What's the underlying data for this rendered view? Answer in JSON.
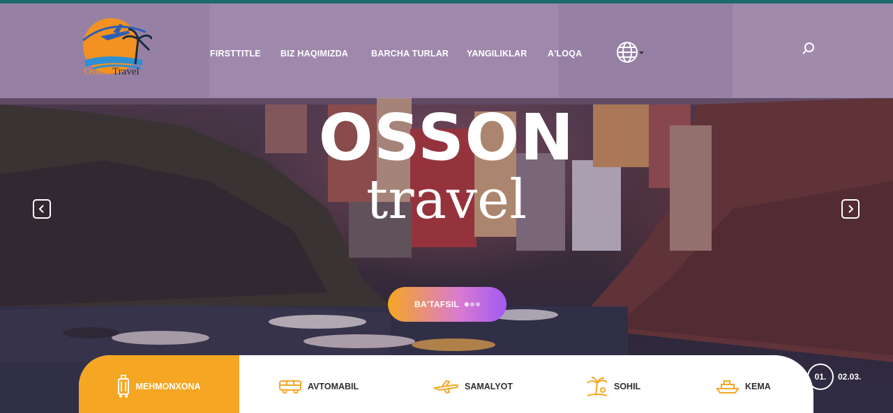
{
  "brand": {
    "name_part1": "Osson",
    "name_part2": "Travel"
  },
  "nav": {
    "items": [
      {
        "label": "FIRSTTITLE"
      },
      {
        "label": "BIZ HAQIMIZDA"
      },
      {
        "label": "BARCHA TURLAR"
      },
      {
        "label": "YANGILIKLAR"
      },
      {
        "label": "A'LOQA"
      }
    ]
  },
  "hero": {
    "title": "OSSON",
    "subtitle": "travel",
    "cta_label": "BA'TAFSIL"
  },
  "tabs": [
    {
      "label": "MEHMONXONA",
      "icon": "luggage-icon",
      "active": true
    },
    {
      "label": "AVTOMABIL",
      "icon": "bus-icon",
      "active": false
    },
    {
      "label": "SAMALYOT",
      "icon": "airplane-icon",
      "active": false
    },
    {
      "label": "SOHIL",
      "icon": "palm-beach-icon",
      "active": false
    },
    {
      "label": "KEMA",
      "icon": "ship-icon",
      "active": false
    }
  ],
  "pager": {
    "current": "01.",
    "rest": "02.03."
  },
  "colors": {
    "accent": "#f5a623",
    "header_tint": "#aa96be",
    "top_line": "#1d6a6c",
    "cta_end": "#a259f0"
  }
}
